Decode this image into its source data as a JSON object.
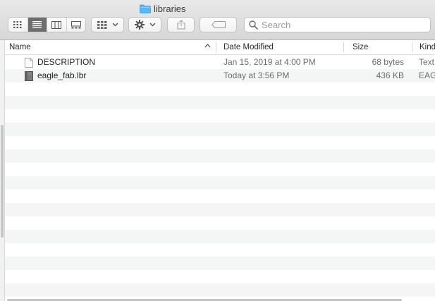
{
  "window": {
    "title": "libraries",
    "folder_color": "#5cb4f5"
  },
  "toolbar": {
    "view_modes": [
      "icon-view-icon",
      "list-view-icon",
      "column-view-icon",
      "gallery-view-icon"
    ],
    "active_view": "list-view-icon",
    "group_button": "group-by-icon",
    "action_button": "gear-icon",
    "share_button": "share-icon",
    "tag_button": "tag-icon"
  },
  "search": {
    "placeholder": "Search",
    "value": ""
  },
  "columns": {
    "name": "Name",
    "date_modified": "Date Modified",
    "size": "Size",
    "kind": "Kind"
  },
  "files": [
    {
      "name": "DESCRIPTION",
      "date_modified": "Jan 15, 2019 at 4:00 PM",
      "size": "68 bytes",
      "kind": "Text",
      "icon": "text-document-icon"
    },
    {
      "name": "eagle_fab.lbr",
      "date_modified": "Today at 3:56 PM",
      "size": "436 KB",
      "kind": "EAG",
      "icon": "library-file-icon"
    }
  ],
  "colors": {
    "stripe": "#f4f5f5",
    "toolbar_top": "#e9e9e9",
    "active_segment": "#6e6e6e"
  }
}
